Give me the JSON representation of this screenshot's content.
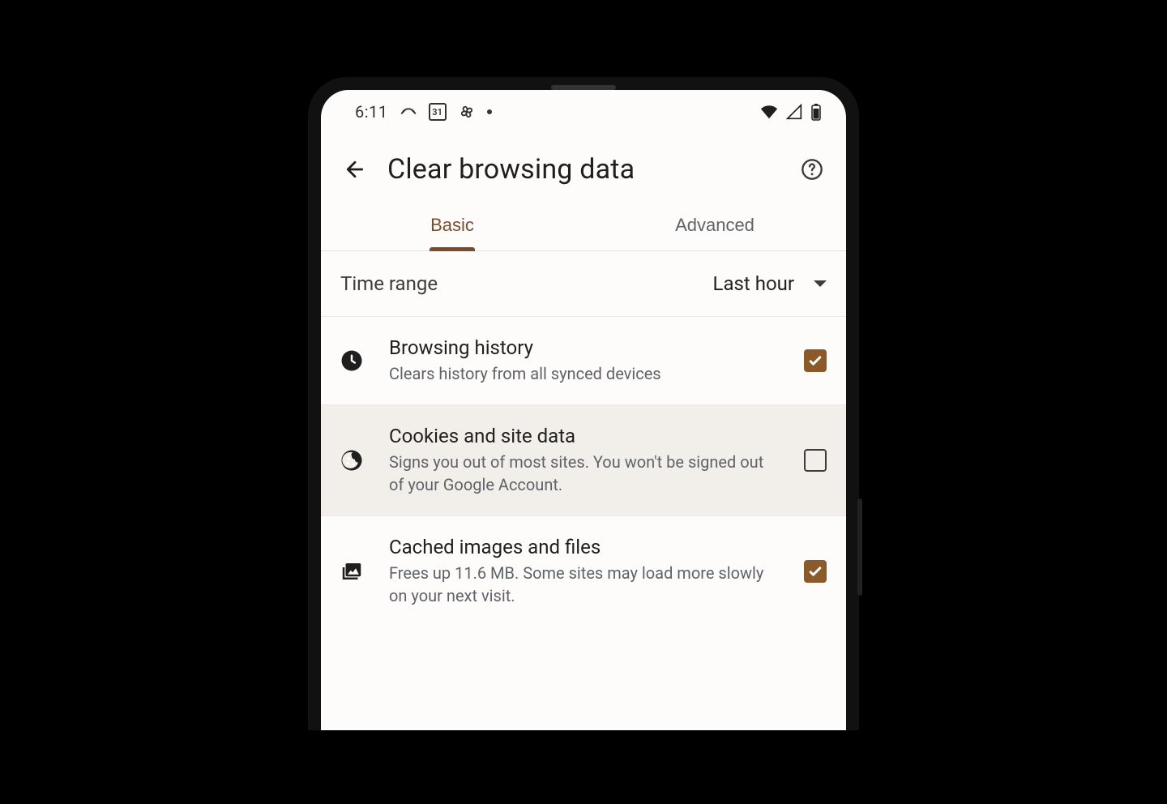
{
  "status": {
    "time": "6:11",
    "calendar_day": "31"
  },
  "appbar": {
    "title": "Clear browsing data"
  },
  "tabs": [
    {
      "label": "Basic",
      "active": true
    },
    {
      "label": "Advanced",
      "active": false
    }
  ],
  "time_range": {
    "label": "Time range",
    "value": "Last hour"
  },
  "options": [
    {
      "id": "history",
      "title": "Browsing history",
      "desc": "Clears history from all synced devices",
      "checked": true,
      "highlighted": false,
      "icon": "clock"
    },
    {
      "id": "cookies",
      "title": "Cookies and site data",
      "desc": "Signs you out of most sites. You won't be signed out of your Google Account.",
      "checked": false,
      "highlighted": true,
      "icon": "cookie"
    },
    {
      "id": "cache",
      "title": "Cached images and files",
      "desc": "Frees up 11.6 MB. Some sites may load more slowly on your next visit.",
      "checked": true,
      "highlighted": false,
      "icon": "images"
    }
  ],
  "colors": {
    "accent": "#7a4c2e",
    "checkbox": "#8b5a2b"
  }
}
